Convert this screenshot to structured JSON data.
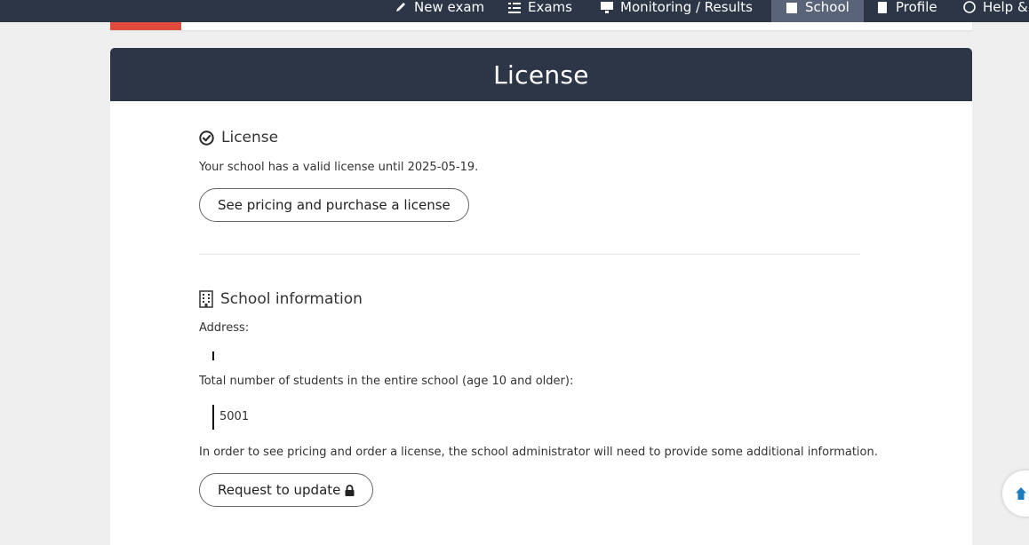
{
  "nav": {
    "items": [
      {
        "label": "New exam",
        "icon": "pencil-icon"
      },
      {
        "label": "Exams",
        "icon": "list-icon"
      },
      {
        "label": "Monitoring / Results",
        "icon": "monitor-icon"
      },
      {
        "label": "School",
        "icon": "school-icon"
      },
      {
        "label": "Profile",
        "icon": "user-icon"
      },
      {
        "label": "Help &",
        "icon": "help-icon"
      }
    ]
  },
  "card": {
    "title": "License"
  },
  "license": {
    "heading": "License",
    "status_text": "Your school has a valid license until 2025-05-19.",
    "pricing_button": "See pricing and purchase a license"
  },
  "school_info": {
    "heading": "School information",
    "address_label": "Address:",
    "address_value": "",
    "students_label": "Total number of students in the entire school (age 10 and older):",
    "students_value": "5001",
    "notice": "In order to see pricing and order a license, the school administrator will need to provide some additional information.",
    "update_button": "Request to update"
  },
  "colors": {
    "nav_bg": "#2c3646",
    "nav_active": "#5a6478",
    "accent_red": "#e14b3b",
    "scroll_arrow": "#1a7bbf"
  }
}
